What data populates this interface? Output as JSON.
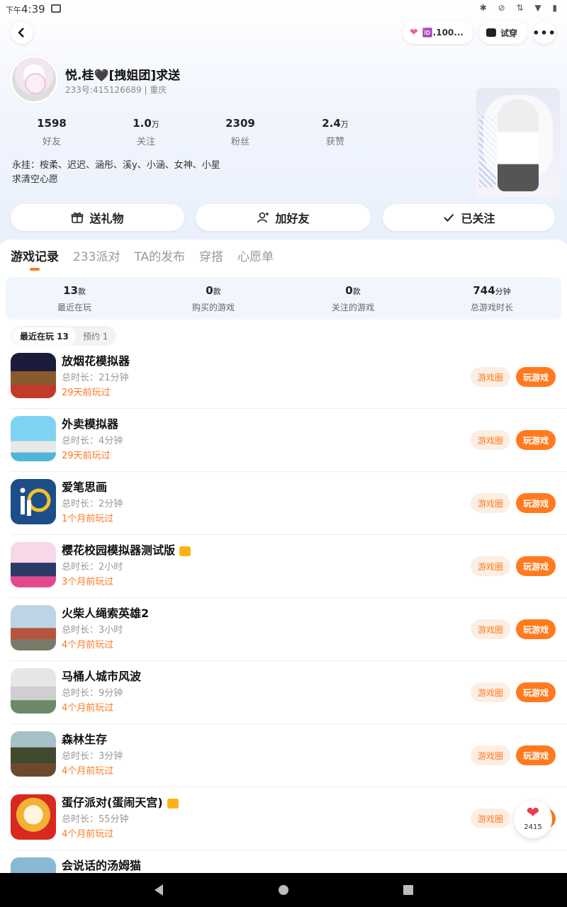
{
  "status_bar": {
    "ampm": "下午",
    "time": "4:39"
  },
  "header": {
    "heart_badge": "🆔.100...",
    "tryon_label": "试穿"
  },
  "profile": {
    "name": "悦.桂🖤[拽姐团]求送",
    "id_line": "233号:415126689 | 重庆",
    "stats": [
      {
        "value": "1598",
        "unit": "",
        "label": "好友"
      },
      {
        "value": "1.0",
        "unit": "万",
        "label": "关注"
      },
      {
        "value": "2309",
        "unit": "",
        "label": "粉丝"
      },
      {
        "value": "2.4",
        "unit": "万",
        "label": "获赞"
      }
    ],
    "bio_line1": "永挂：桉柔、迟迟、涵彤、溪y、小涵、女神、小星",
    "bio_line2": "求清空心愿"
  },
  "actions": {
    "gift": "送礼物",
    "add_friend": "加好友",
    "followed": "已关注"
  },
  "tabs": [
    "游戏记录",
    "233派对",
    "TA的发布",
    "穿搭",
    "心愿单"
  ],
  "summary": [
    {
      "value": "13",
      "unit": "款",
      "label": "最近在玩"
    },
    {
      "value": "0",
      "unit": "款",
      "label": "购买的游戏"
    },
    {
      "value": "0",
      "unit": "款",
      "label": "关注的游戏"
    },
    {
      "value": "744",
      "unit": "分钟",
      "label": "总游戏时长"
    }
  ],
  "filters": {
    "recent": "最近在玩 13",
    "reserve": "预约 1"
  },
  "buttons": {
    "circle": "游戏圈",
    "play": "玩游戏"
  },
  "games": [
    {
      "name": "放烟花模拟器",
      "duration": "总时长：21分钟",
      "last": "29天前玩过",
      "gift": false
    },
    {
      "name": "外卖模拟器",
      "duration": "总时长：4分钟",
      "last": "29天前玩过",
      "gift": false
    },
    {
      "name": "爱笔思画",
      "duration": "总时长：2分钟",
      "last": "1个月前玩过",
      "gift": false
    },
    {
      "name": "樱花校园模拟器测试版",
      "duration": "总时长：2小时",
      "last": "3个月前玩过",
      "gift": true
    },
    {
      "name": "火柴人绳索英雄2",
      "duration": "总时长：3小时",
      "last": "4个月前玩过",
      "gift": false
    },
    {
      "name": "马桶人城市风波",
      "duration": "总时长：9分钟",
      "last": "4个月前玩过",
      "gift": false
    },
    {
      "name": "森林生存",
      "duration": "总时长：3分钟",
      "last": "4个月前玩过",
      "gift": false
    },
    {
      "name": "蛋仔派对(蛋闹天宫)",
      "duration": "总时长：55分钟",
      "last": "4个月前玩过",
      "gift": true
    },
    {
      "name": "会说话的汤姆猫",
      "duration": "",
      "last": "",
      "gift": false
    }
  ],
  "likes_count": "2415",
  "colors": {
    "accent": "#ff7a1e",
    "accent_light": "#fdeee3",
    "header_bg": "#e9f0fc"
  }
}
